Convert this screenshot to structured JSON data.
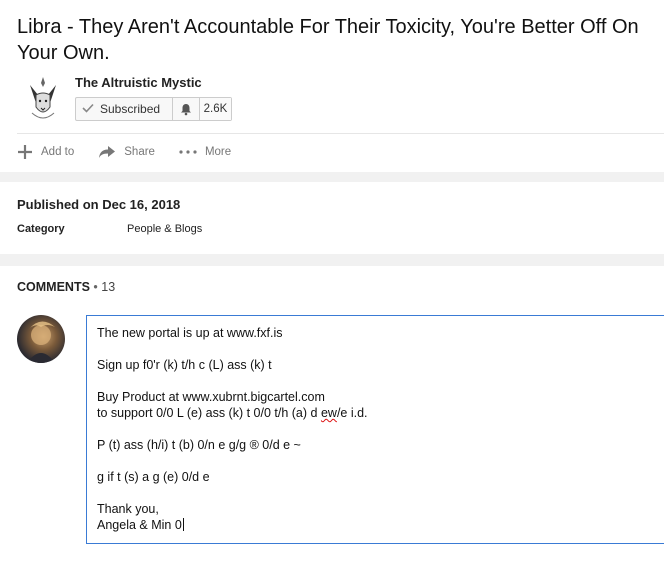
{
  "video": {
    "title": "Libra - They Aren't Accountable For Their Toxicity, You're Better Off On Your Own.",
    "channel": {
      "name": "The Altruistic Mystic",
      "subscribe_label": "Subscribed",
      "subscriber_count": "2.6K"
    },
    "actions": {
      "add_to": "Add to",
      "share": "Share",
      "more": "More"
    }
  },
  "meta": {
    "published": "Published on Dec 16, 2018",
    "category_label": "Category",
    "category_value": "People & Blogs"
  },
  "comments": {
    "header_label": "COMMENTS",
    "separator": "•",
    "count": "13",
    "draft": {
      "line1": "The new portal is up at www.fxf.is",
      "line2": "Sign up f0'r (k) t/h c (L) ass (k) t",
      "line3": "Buy Product at www.xubrnt.bigcartel.com",
      "line4_pre": "to support 0/0 L (e) ass (k) t 0/0 t/h (a) d ",
      "line4_misspelled": "ew",
      "line4_post": "/e i.d.",
      "line5": "P (t) ass (h/i) t (b) 0/n e g/g ® 0/d e ~",
      "line6": "g if t (s) a g (e) 0/d e",
      "line7": "Thank you,",
      "line8": "Angela & Min 0"
    }
  },
  "colors": {
    "accent_blue": "#3a7bd5",
    "background": "#f1f1f1",
    "card": "#ffffff"
  }
}
